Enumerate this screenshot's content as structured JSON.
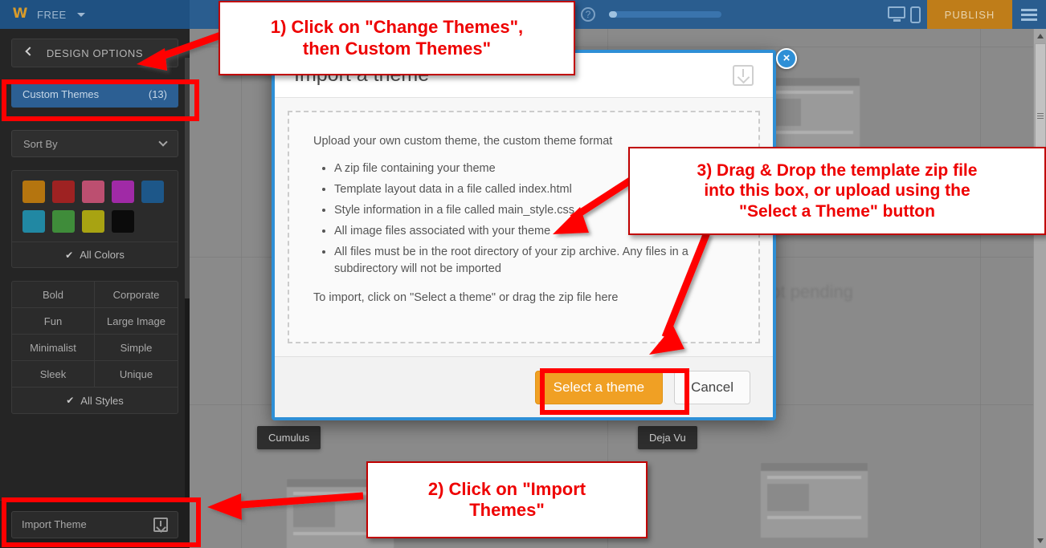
{
  "topbar": {
    "logo": "W",
    "plan_label": "FREE",
    "publish_label": "PUBLISH",
    "icons": [
      "help-icon",
      "desktop-view-icon",
      "mobile-view-icon",
      "hamburger-menu-icon"
    ]
  },
  "sidebar": {
    "design_options_label": "DESIGN OPTIONS",
    "custom_themes_label": "Custom Themes",
    "custom_themes_count": "(13)",
    "sort_by_label": "Sort By",
    "colors": [
      "#b5750f",
      "#9e2222",
      "#bc4f70",
      "#a02aa6",
      "#1e5party",
      "#2188a3",
      "#3f8c3a",
      "#a8a312",
      "#0b0b0b"
    ],
    "color_swatches": [
      "#b5750f",
      "#9e2222",
      "#bc4f70",
      "#a02aa6",
      "#1d5789",
      "#2188a3",
      "#3f8c3a",
      "#a8a312",
      "#0b0b0b"
    ],
    "all_colors_label": "All Colors",
    "styles": [
      "Bold",
      "Corporate",
      "Fun",
      "Large Image",
      "Minimalist",
      "Simple",
      "Sleek",
      "Unique"
    ],
    "all_styles_label": "All Styles",
    "import_theme_label": "Import Theme"
  },
  "canvas": {
    "pending_text": "shot pending",
    "theme_tags": [
      "Cumulus",
      "Deja Vu"
    ]
  },
  "modal": {
    "title": "Import a theme",
    "lead": "Upload your own custom theme, the custom theme format",
    "bullets": [
      "A zip file containing your theme",
      "Template layout data in a file called index.html",
      "Style information in a file called main_style.css",
      "All image files associated with your theme",
      "All files must be in the root directory of your zip archive. Any files in a subdirectory will not be imported"
    ],
    "closing": "To import, click on \"Select a theme\" or drag the zip file here",
    "select_button": "Select a theme",
    "cancel_button": "Cancel",
    "close_icon": "×"
  },
  "annotations": {
    "callout_1": "1) Click on \"Change Themes\",\nthen Custom Themes\"",
    "callout_1_line1": "1) Click on \"Change Themes\",",
    "callout_1_line2": "then Custom Themes\"",
    "callout_2_line1": "2) Click on \"Import",
    "callout_2_line2": "Themes\"",
    "callout_3_line1": "3) Drag & Drop the template zip file",
    "callout_3_line2": "into this box, or upload using the",
    "callout_3_line3": "\"Select a Theme\" button",
    "highlight_color": "#ff0000",
    "text_color": "#ee0000"
  },
  "colors": {
    "topbar_blue": "#2a5d8f",
    "accent_orange": "#f0a024",
    "publish_orange": "#bf7d19",
    "modal_border_blue": "#2e8fd6",
    "sidebar_dark": "#252525",
    "canvas_gray": "#8a8a8a"
  }
}
